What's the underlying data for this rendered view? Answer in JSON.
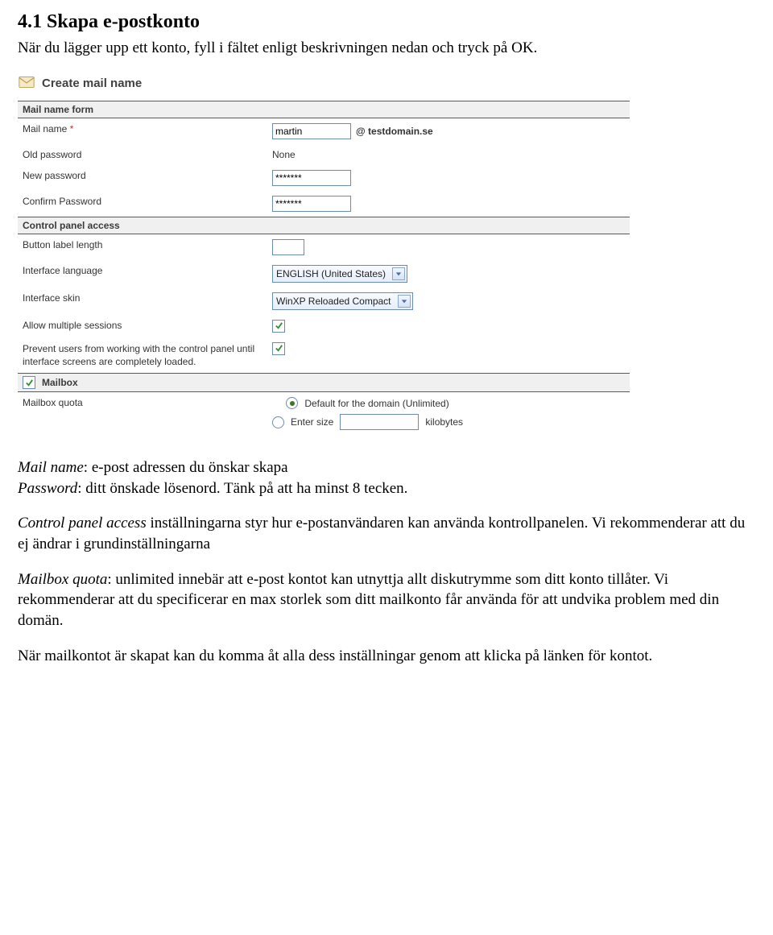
{
  "doc": {
    "heading": "4.1 Skapa e-postkonto",
    "intro": "När du lägger upp ett konto, fyll i fältet enligt beskrivningen nedan och tryck på OK.",
    "p_mail_label": "Mail name",
    "p_mail_text": ": e-post adressen du önskar skapa",
    "p_pw_label": "Password",
    "p_pw_text": ": ditt önskade lösenord. Tänk på att ha minst 8 tecken.",
    "p_cpa_label": "Control panel access",
    "p_cpa_text": " inställningarna styr hur e-postanvändaren kan använda kontrollpanelen. Vi rekommenderar att du ej ändrar i grundinställningarna",
    "p_quota_label": "Mailbox quota",
    "p_quota_text": ": unlimited innebär att e-post kontot kan utnyttja allt diskutrymme som ditt konto tillåter. Vi rekommenderar att du specificerar en max storlek som ditt mailkonto får använda för att undvika problem med din domän.",
    "p_end": "När mailkontot är skapat kan du komma åt alla dess inställningar genom att klicka på länken för kontot."
  },
  "form": {
    "title": "Create mail name",
    "section_mailname": "Mail name form",
    "labels": {
      "mail_name": "Mail name",
      "required_mark": "*",
      "old_password": "Old password",
      "new_password": "New password",
      "confirm_password": "Confirm Password",
      "button_label_length": "Button label length",
      "interface_language": "Interface language",
      "interface_skin": "Interface skin",
      "allow_multiple": "Allow multiple sessions",
      "prevent_users": "Prevent users from working with the control panel until interface screens are completely loaded.",
      "mailbox": "Mailbox",
      "mailbox_quota": "Mailbox quota",
      "quota_default": "Default for the domain (Unlimited)",
      "quota_enter": "Enter size",
      "quota_unit": "kilobytes"
    },
    "values": {
      "mail_name": "martin",
      "domain": "@ testdomain.se",
      "old_password": "None",
      "new_password": "*******",
      "confirm_password": "*******",
      "button_label_length": "",
      "interface_language": "ENGLISH (United States)",
      "interface_skin": "WinXP Reloaded Compact",
      "allow_multiple_checked": true,
      "prevent_users_checked": true,
      "mailbox_checked": true,
      "quota_default_selected": true,
      "quota_size": ""
    },
    "section_cpa": "Control panel access"
  }
}
